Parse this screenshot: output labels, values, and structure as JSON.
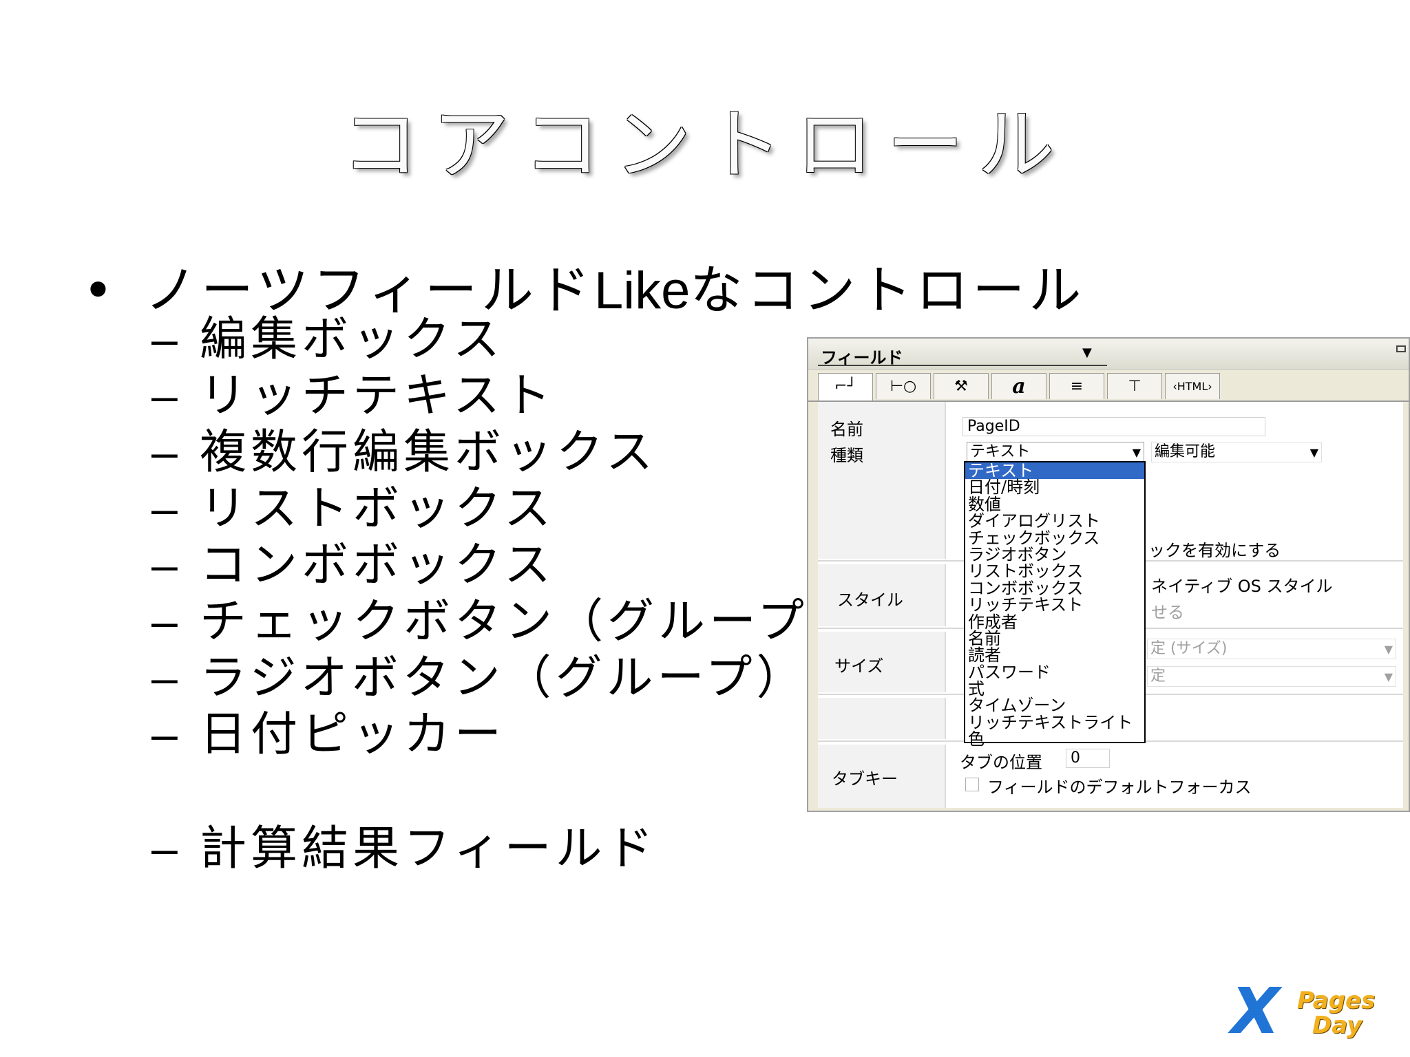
{
  "title": "コアコントロール",
  "bullet": {
    "pre": "ノーツフィールド",
    "latin": "Like",
    "post": "なコントロール"
  },
  "dash": "–",
  "sub_items": [
    "編集ボックス",
    "リッチテキスト",
    "複数行編集ボックス",
    "リストボックス",
    "コンボボックス",
    "チェックボタン（グループ）",
    "ラジオボタン（グループ）",
    "日付ピッカー"
  ],
  "sub_item_last": "計算結果フィールド",
  "dialog": {
    "title": "フィールド",
    "tabs": [
      "⌐┘",
      "⊢○",
      "⚒",
      "a",
      "≡",
      "⊤",
      "‹HTML›"
    ],
    "name_label": "名前",
    "name_value": "PageID",
    "type_label": "種類",
    "type_value": "テキスト",
    "editable_value": "編集可能",
    "partial_check_text": "ックを有効にする",
    "style_label": "スタイル",
    "style_text1": "ネイティブ OS スタイル",
    "style_text2": "せる",
    "size_label": "サイズ",
    "size_select1": "定 (サイズ)",
    "size_select2": "定",
    "tabkey_label": "タブキー",
    "tab_position_label": "タブの位置",
    "tab_position_value": "0",
    "default_focus_label": "フィールドのデフォルトフォーカス",
    "type_options": [
      "テキスト",
      "日付/時刻",
      "数値",
      "ダイアログリスト",
      "チェックボックス",
      "ラジオボタン",
      "リストボックス",
      "コンボボックス",
      "リッチテキスト",
      "作成者",
      "名前",
      "読者",
      "パスワード",
      "式",
      "タイムゾーン",
      "リッチテキストライト",
      "色"
    ],
    "selected_option": "テキスト"
  },
  "logo": {
    "x": "X",
    "pages": "Pages",
    "day": "Day"
  },
  "colors": {
    "selection": "#3169c6",
    "logo_blue": "#1f74d6",
    "logo_gold": "#f2b01e"
  }
}
